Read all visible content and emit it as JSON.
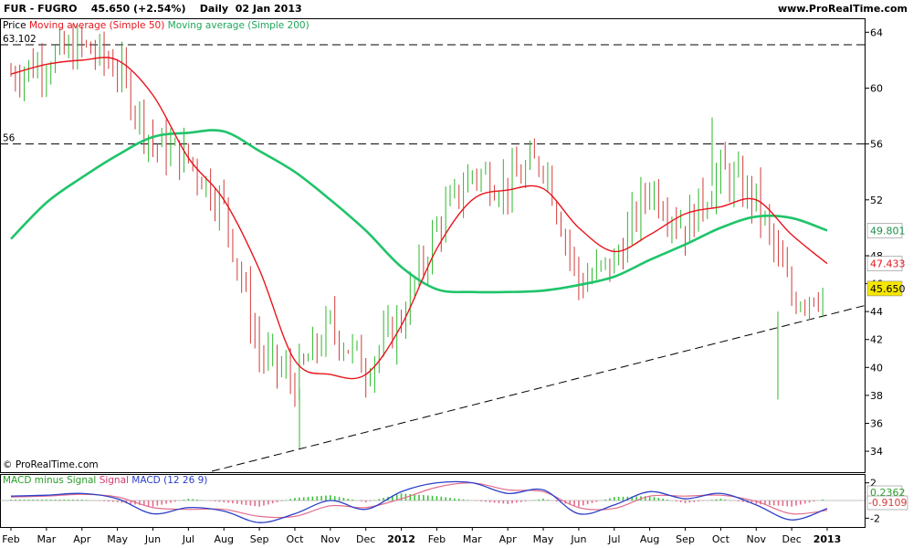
{
  "header": {
    "left": "FUR - FUGRO    45.650 (+2.54%)    Daily  02 Jan 2013",
    "right": "www.ProRealTime.com"
  },
  "legend_main": {
    "price": "Price",
    "ma50": "Moving average (Simple 50)",
    "ma200": "Moving average (Simple 200)"
  },
  "legend_macd": {
    "hist": "MACD minus Signal",
    "signal": "Signal",
    "macd": "MACD (12 26 9)"
  },
  "copyright": "© ProRealTime.com",
  "colors": {
    "bar": "#2db82d",
    "bar_down": "#d23c3c",
    "ma50": "#e8141c",
    "ma200": "#1fc46a",
    "macd": "#2a3fc8",
    "macd_hist_pos": "#3cc23c",
    "macd_hist_neg": "#e36d8c",
    "last_price_bg": "#f5e600",
    "border": "#000000"
  },
  "chart_data": [
    {
      "type": "ohlc",
      "title": "FUR - FUGRO",
      "ylim": [
        32.5,
        65
      ],
      "y_ticks": [
        34,
        36,
        38,
        40,
        42,
        44,
        46,
        48,
        52,
        56,
        60,
        64
      ],
      "x_ticks": [
        "Feb",
        "Mar",
        "Apr",
        "May",
        "Jun",
        "Jul",
        "Aug",
        "Sep",
        "Oct",
        "Nov",
        "Dec",
        "2012",
        "Feb",
        "Mar",
        "Apr",
        "May",
        "Jun",
        "Jul",
        "Aug",
        "Sep",
        "Oct",
        "Nov",
        "Dec",
        "2013"
      ],
      "horizontal_lines": [
        {
          "label": "63.102",
          "value": 63.102
        },
        {
          "label": "56",
          "value": 56
        }
      ],
      "trendline": {
        "from": [
          "Aug 2011",
          32.5
        ],
        "to": [
          "Jan 2013",
          44.3
        ]
      },
      "price_series_monthly": {
        "x": [
          "Feb",
          "Mar",
          "Apr",
          "May",
          "Jun",
          "Jul",
          "Aug",
          "Sep",
          "Oct",
          "Nov",
          "Dec",
          "2012",
          "Feb",
          "Mar",
          "Apr",
          "May",
          "Jun",
          "Jul",
          "Aug",
          "Sep",
          "Oct",
          "Nov",
          "Dec",
          "2013"
        ],
        "close": [
          61,
          62,
          63,
          61.5,
          56,
          55,
          51.5,
          41,
          39,
          43,
          40,
          43.5,
          50,
          54,
          53,
          55,
          46,
          47.5,
          53,
          50,
          54,
          52,
          45,
          45.65
        ]
      },
      "series": [
        {
          "name": "Moving average (Simple 50)",
          "x": [
            "Feb",
            "Mar",
            "Apr",
            "May",
            "Jun",
            "Jul",
            "Aug",
            "Sep",
            "Oct",
            "Nov",
            "Dec",
            "2012",
            "Feb",
            "Mar",
            "Apr",
            "May",
            "Jun",
            "Jul",
            "Aug",
            "Sep",
            "Oct",
            "Nov",
            "Dec",
            "2013"
          ],
          "values": [
            61,
            61.7,
            62,
            62,
            59.5,
            55,
            52,
            47,
            40.5,
            39.5,
            39.5,
            43,
            48.5,
            52,
            52.7,
            52.8,
            50,
            48.3,
            49.5,
            51,
            51.5,
            52,
            49.5,
            47.433
          ],
          "last": 47.433
        },
        {
          "name": "Moving average (Simple 200)",
          "x": [
            "Feb",
            "Mar",
            "Apr",
            "May",
            "Jun",
            "Jul",
            "Aug",
            "Sep",
            "Oct",
            "Nov",
            "Dec",
            "2012",
            "Feb",
            "Mar",
            "Apr",
            "May",
            "Jun",
            "Jul",
            "Aug",
            "Sep",
            "Oct",
            "Nov",
            "Dec",
            "2013"
          ],
          "values": [
            49.2,
            51.8,
            53.6,
            55.2,
            56.5,
            56.8,
            56.9,
            55.5,
            54,
            52,
            49.8,
            47.2,
            45.6,
            45.4,
            45.4,
            45.5,
            45.9,
            46.5,
            47.7,
            48.8,
            50,
            50.8,
            50.7,
            49.801
          ],
          "last": 49.801
        }
      ],
      "last_price": {
        "label": "45.650",
        "value": 45.65
      }
    },
    {
      "type": "macd",
      "title": "MACD (12 26 9)",
      "ylim": [
        -3,
        3
      ],
      "y_ticks": [
        -2,
        2
      ],
      "series": [
        {
          "name": "MACD",
          "x": [
            "Feb",
            "Mar",
            "Apr",
            "May",
            "Jun",
            "Jul",
            "Aug",
            "Sep",
            "Oct",
            "Nov",
            "Dec",
            "2012",
            "Feb",
            "Mar",
            "Apr",
            "May",
            "Jun",
            "Jul",
            "Aug",
            "Sep",
            "Oct",
            "Nov",
            "Dec",
            "2013"
          ],
          "values": [
            0.5,
            0.6,
            0.8,
            0.2,
            -1.5,
            -0.8,
            -1.2,
            -2.5,
            -1.5,
            0,
            -1.0,
            1.0,
            2.0,
            2.0,
            0.8,
            1.2,
            -1.5,
            -0.5,
            1.0,
            0.2,
            0.8,
            -0.5,
            -2.2,
            -0.9109
          ]
        },
        {
          "name": "Signal",
          "x": [
            "Feb",
            "Mar",
            "Apr",
            "May",
            "Jun",
            "Jul",
            "Aug",
            "Sep",
            "Oct",
            "Nov",
            "Dec",
            "2012",
            "Feb",
            "Mar",
            "Apr",
            "May",
            "Jun",
            "Jul",
            "Aug",
            "Sep",
            "Oct",
            "Nov",
            "Dec",
            "2013"
          ],
          "values": [
            0.4,
            0.5,
            0.7,
            0.4,
            -0.8,
            -1.0,
            -1.0,
            -1.8,
            -1.8,
            -0.6,
            -0.8,
            0.2,
            1.5,
            2.0,
            1.2,
            1.0,
            -0.8,
            -0.9,
            0.5,
            0.5,
            0.6,
            -0.1,
            -1.5,
            -1.1
          ]
        },
        {
          "name": "MACD minus Signal",
          "x": [
            "Feb",
            "Mar",
            "Apr",
            "May",
            "Jun",
            "Jul",
            "Aug",
            "Sep",
            "Oct",
            "Nov",
            "Dec",
            "2012",
            "Feb",
            "Mar",
            "Apr",
            "May",
            "Jun",
            "Jul",
            "Aug",
            "Sep",
            "Oct",
            "Nov",
            "Dec",
            "2013"
          ],
          "values": [
            0.1,
            0.1,
            0.1,
            -0.2,
            -0.7,
            0.2,
            -0.2,
            -0.7,
            0.3,
            0.6,
            -0.2,
            0.8,
            0.5,
            0.0,
            -0.4,
            0.2,
            -0.7,
            0.4,
            0.5,
            -0.3,
            0.2,
            -0.4,
            -0.7,
            0.2362
          ]
        }
      ],
      "last_values": {
        "hist": "0.2362",
        "macd": "-0.9109"
      }
    }
  ]
}
